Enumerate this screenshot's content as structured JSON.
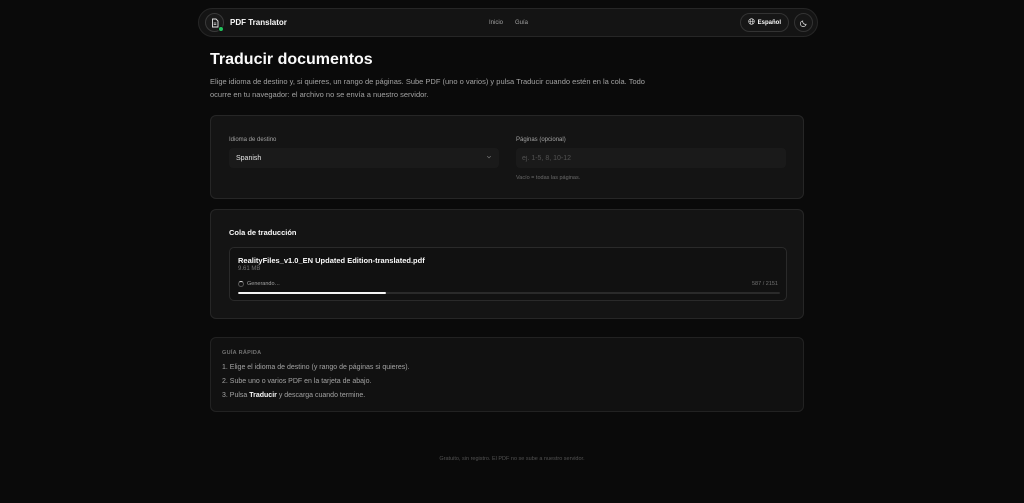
{
  "navbar": {
    "brand": "PDF Translator",
    "links": [
      "Inicio",
      "Guía"
    ],
    "language_button": "Español",
    "brand_icon": "file-document-icon",
    "status_dot_color": "#22c55e"
  },
  "hero": {
    "title": "Traducir documentos",
    "description": "Elige idioma de destino y, si quieres, un rango de páginas. Sube PDF (uno o varios) y pulsa Traducir cuando estén en la cola. Todo ocurre en tu navegador: el archivo no se envía a nuestro servidor."
  },
  "settings": {
    "target_language_label": "Idioma de destino",
    "target_language_value": "Spanish",
    "pages_label": "Páginas (opcional)",
    "pages_placeholder": "ej. 1-5, 8, 10-12",
    "pages_value": "",
    "pages_hint": "Vacío = todas las páginas."
  },
  "queue": {
    "title": "Cola de traducción",
    "items": [
      {
        "name": "RealityFiles_v1.0_EN Updated Edition-translated.pdf",
        "size": "9.61 MB",
        "status": "Generando…",
        "counter": "587 / 2151",
        "progress_fraction": 0.273
      }
    ]
  },
  "guide": {
    "title": "GUÍA RÁPIDA",
    "step1": "1. Elige el idioma de destino (y rango de páginas si quieres).",
    "step2": "2. Sube uno o varios PDF en la tarjeta de abajo.",
    "step3_prefix": "3. Pulsa ",
    "step3_bold": "Traducir",
    "step3_suffix": " y descarga cuando termine."
  },
  "footer": {
    "text": "Gratuito, sin registro. El PDF no se sube a nuestro servidor."
  }
}
